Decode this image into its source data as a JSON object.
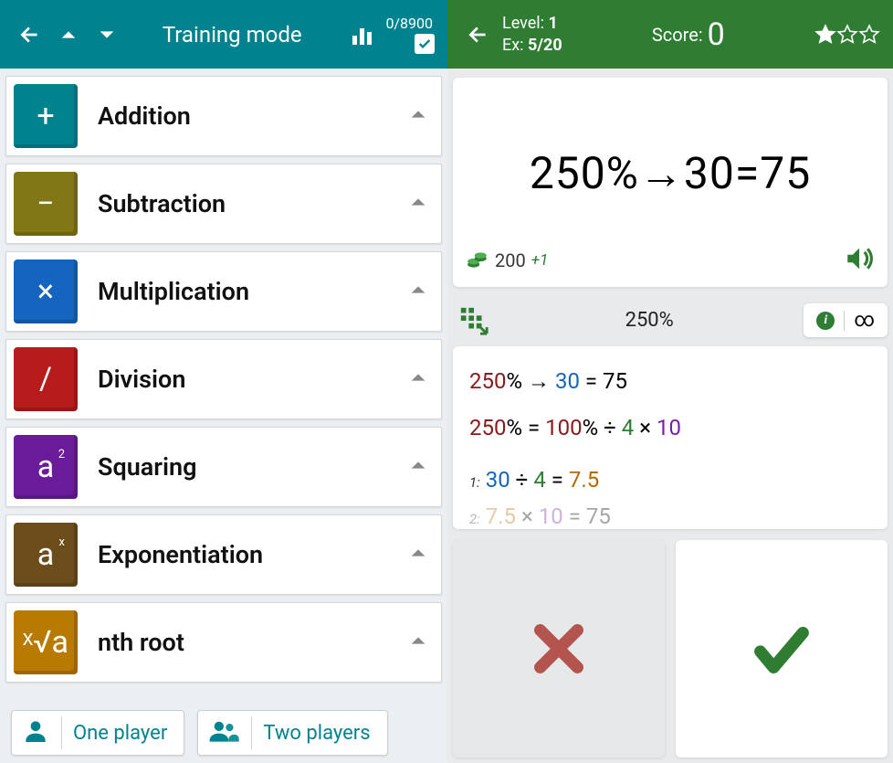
{
  "left": {
    "title": "Training mode",
    "progress": "0/8900",
    "operations": [
      {
        "label": "Addition",
        "symbol": "+",
        "color": "#00838f"
      },
      {
        "label": "Subtraction",
        "symbol": "−",
        "color": "#827717"
      },
      {
        "label": "Multiplication",
        "symbol": "×",
        "color": "#1565c0"
      },
      {
        "label": "Division",
        "symbol": "/",
        "color": "#b71c1c"
      },
      {
        "label": "Squaring",
        "symbol": "a",
        "sup": "2",
        "color": "#6a1b9a"
      },
      {
        "label": "Exponentiation",
        "symbol": "a",
        "sup": "x",
        "color": "#6d4c1b"
      },
      {
        "label": "nth root",
        "symbol": "ˣ√a",
        "color": "#b87a00"
      }
    ],
    "players": {
      "one": "One player",
      "two": "Two players"
    }
  },
  "right": {
    "header": {
      "level_label": "Level:",
      "level_value": "1",
      "ex_label": "Ex:",
      "ex_value": "5/20",
      "score_label": "Score:",
      "score_value": "0",
      "stars_filled": 1,
      "stars_total": 3
    },
    "question": {
      "equation": "250%→30=75",
      "coins_value": "200",
      "coins_delta": "+1"
    },
    "hint": {
      "center": "250%",
      "right": "∞"
    },
    "work": {
      "line1": {
        "a": "250",
        "pct": "%",
        "arrow": " → ",
        "b": "30",
        "eq": " = 75"
      },
      "line2": {
        "a": "250",
        "pct": "% = ",
        "b": "100",
        "pct2": "% ÷ ",
        "c": "4",
        "mul": " × ",
        "d": "10"
      },
      "step1": {
        "num": "1:",
        "a": "30",
        "div": " ÷ ",
        "b": "4",
        "eq": " = ",
        "r": "7.5"
      },
      "step2": {
        "num": "2:",
        "a": "7.5",
        "mul": " × ",
        "b": "10",
        "eq": " = ",
        "r": "75"
      }
    }
  }
}
